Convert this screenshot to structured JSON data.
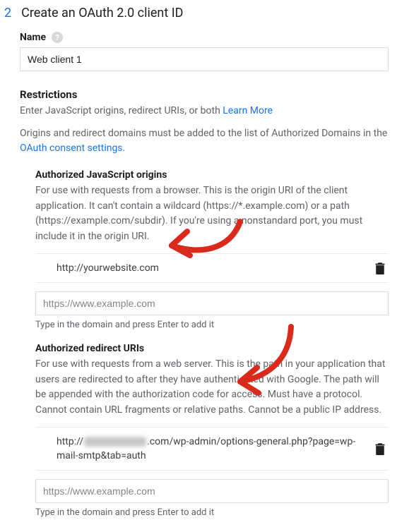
{
  "step": {
    "number": "2",
    "title": "Create an OAuth 2.0 client ID"
  },
  "name": {
    "label": "Name",
    "value": "Web client 1"
  },
  "restrictions": {
    "heading": "Restrictions",
    "intro_text": "Enter JavaScript origins, redirect URIs, or both ",
    "learn_more": "Learn More",
    "domains_text_a": "Origins and redirect domains must be added to the list of Authorized Domains in the ",
    "consent_link": "OAuth consent settings",
    "domains_text_b": "."
  },
  "js_origins": {
    "heading": "Authorized JavaScript origins",
    "description": "For use with requests from a browser. This is the origin URI of the client application. It can't contain a wildcard (https://*.example.com) or a path (https://example.com/subdir). If you're using a nonstandard port, you must include it in the origin URI.",
    "entries": [
      {
        "value": "http://yourwebsite.com"
      }
    ],
    "placeholder": "https://www.example.com",
    "helper": "Type in the domain and press Enter to add it"
  },
  "redirect_uris": {
    "heading": "Authorized redirect URIs",
    "description": "For use with requests from a web server. This is the path in your application that users are redirected to after they have authenticated with Google. The path will be appended with the authorization code for access. Must have a protocol. Cannot contain URL fragments or relative paths. Cannot be a public IP address.",
    "entries": [
      {
        "prefix": "http://",
        "suffix": ".com/wp-admin/options-general.php?page=wp-mail-smtp&tab=auth"
      }
    ],
    "placeholder": "https://www.example.com",
    "helper": "Type in the domain and press Enter to add it"
  },
  "icons": {
    "help": "?",
    "trash": "trash"
  }
}
